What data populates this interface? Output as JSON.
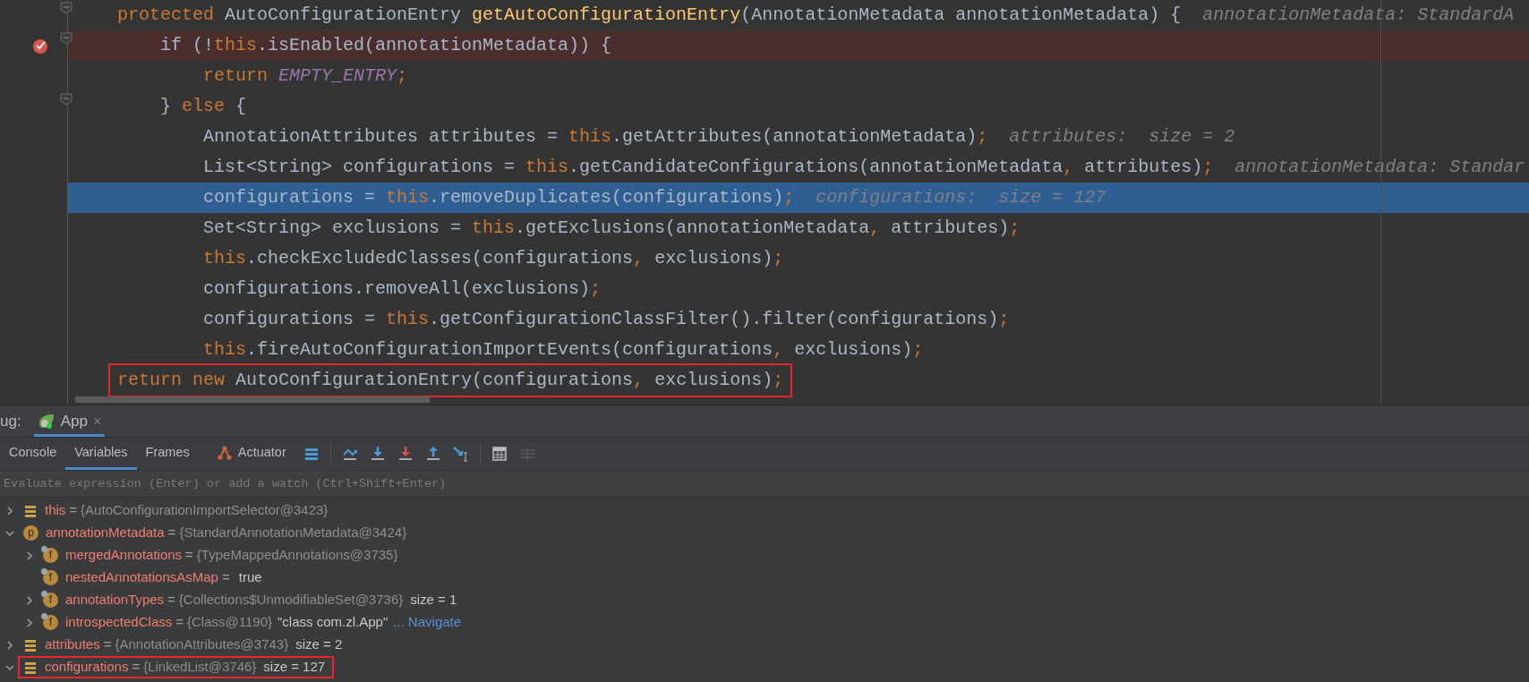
{
  "editor": {
    "lines": [
      {
        "kind": "normal",
        "fold": true,
        "segments": [
          {
            "kind": "keyword",
            "text": "protected "
          },
          {
            "kind": "plain",
            "text": "AutoConfigurationEntry "
          },
          {
            "kind": "method",
            "text": "getAutoConfigurationEntry"
          },
          {
            "kind": "plain",
            "text": "(AnnotationMetadata annotationMetadata) {"
          }
        ],
        "hint": "annotationMetadata: StandardA"
      },
      {
        "kind": "breakpoint",
        "fold": true,
        "segments": [
          {
            "kind": "plain",
            "text": "    if (!"
          },
          {
            "kind": "keyword",
            "text": "this"
          },
          {
            "kind": "plain",
            "text": ".isEnabled(annotationMetadata)) {"
          }
        ]
      },
      {
        "kind": "normal",
        "fold": false,
        "segments": [
          {
            "kind": "keyword",
            "text": "        return "
          },
          {
            "kind": "constant",
            "text": "EMPTY_ENTRY"
          },
          {
            "kind": "punct",
            "text": ";"
          }
        ]
      },
      {
        "kind": "normal",
        "fold": true,
        "segments": [
          {
            "kind": "plain",
            "text": "    } "
          },
          {
            "kind": "keyword",
            "text": "else"
          },
          {
            "kind": "plain",
            "text": " {"
          }
        ]
      },
      {
        "kind": "normal",
        "fold": false,
        "segments": [
          {
            "kind": "plain",
            "text": "        AnnotationAttributes attributes = "
          },
          {
            "kind": "keyword",
            "text": "this"
          },
          {
            "kind": "plain",
            "text": ".getAttributes(annotationMetadata)"
          },
          {
            "kind": "punct",
            "text": ";"
          }
        ],
        "hint": "attributes:  size = 2"
      },
      {
        "kind": "normal",
        "fold": false,
        "segments": [
          {
            "kind": "plain",
            "text": "        List<String> configurations = "
          },
          {
            "kind": "keyword",
            "text": "this"
          },
          {
            "kind": "plain",
            "text": ".getCandidateConfigurations(annotationMetadata"
          },
          {
            "kind": "punct",
            "text": ","
          },
          {
            "kind": "plain",
            "text": " attributes)"
          },
          {
            "kind": "punct",
            "text": ";"
          }
        ],
        "hint": "annotationMetadata: Standar"
      },
      {
        "kind": "execution",
        "fold": false,
        "segments": [
          {
            "kind": "plain",
            "text": "        configurations = "
          },
          {
            "kind": "keyword",
            "text": "this"
          },
          {
            "kind": "plain",
            "text": ".removeDuplicates(configurations)"
          },
          {
            "kind": "punct",
            "text": ";"
          }
        ],
        "hint": "configurations:  size = 127"
      },
      {
        "kind": "normal",
        "fold": false,
        "segments": [
          {
            "kind": "plain",
            "text": "        Set<String> exclusions = "
          },
          {
            "kind": "keyword",
            "text": "this"
          },
          {
            "kind": "plain",
            "text": ".getExclusions(annotationMetadata"
          },
          {
            "kind": "punct",
            "text": ","
          },
          {
            "kind": "plain",
            "text": " attributes)"
          },
          {
            "kind": "punct",
            "text": ";"
          }
        ]
      },
      {
        "kind": "normal",
        "fold": false,
        "segments": [
          {
            "kind": "keyword",
            "text": "        this"
          },
          {
            "kind": "plain",
            "text": ".checkExcludedClasses(configurations"
          },
          {
            "kind": "punct",
            "text": ","
          },
          {
            "kind": "plain",
            "text": " exclusions)"
          },
          {
            "kind": "punct",
            "text": ";"
          }
        ]
      },
      {
        "kind": "normal",
        "fold": false,
        "segments": [
          {
            "kind": "plain",
            "text": "        configurations.removeAll(exclusions)"
          },
          {
            "kind": "punct",
            "text": ";"
          }
        ]
      },
      {
        "kind": "normal",
        "fold": false,
        "segments": [
          {
            "kind": "plain",
            "text": "        configurations = "
          },
          {
            "kind": "keyword",
            "text": "this"
          },
          {
            "kind": "plain",
            "text": ".getConfigurationClassFilter().filter(configurations)"
          },
          {
            "kind": "punct",
            "text": ";"
          }
        ]
      },
      {
        "kind": "normal",
        "fold": false,
        "segments": [
          {
            "kind": "keyword",
            "text": "        this"
          },
          {
            "kind": "plain",
            "text": ".fireAutoConfigurationImportEvents(configurations"
          },
          {
            "kind": "punct",
            "text": ","
          },
          {
            "kind": "plain",
            "text": " exclusions)"
          },
          {
            "kind": "punct",
            "text": ";"
          }
        ]
      },
      {
        "kind": "boxed",
        "fold": false,
        "segments": [
          {
            "kind": "keyword",
            "text": "return "
          },
          {
            "kind": "keyword",
            "text": "new "
          },
          {
            "kind": "plain",
            "text": "AutoConfigurationEntry(configurations"
          },
          {
            "kind": "punct",
            "text": ","
          },
          {
            "kind": "plain",
            "text": " exclusions)"
          },
          {
            "kind": "punct",
            "text": ";"
          }
        ]
      }
    ]
  },
  "debug": {
    "label": "ug:",
    "session_tabs": [
      {
        "label": "App",
        "selected": true,
        "close": "×"
      }
    ],
    "tabs": [
      {
        "label": "Console",
        "selected": false
      },
      {
        "label": "Variables",
        "selected": true
      },
      {
        "label": "Frames",
        "selected": false
      },
      {
        "label": "Actuator",
        "selected": false
      }
    ],
    "watch": {
      "placeholder": "Evaluate expression (Enter) or add a watch (Ctrl+Shift+Enter)"
    },
    "variables": [
      {
        "expanded": false,
        "kind": "variable",
        "name": "this",
        "operator": "=",
        "value": "{AutoConfigurationImportSelector@3423}",
        "boxed": false
      },
      {
        "expanded": true,
        "kind": "parameter",
        "badge": "p",
        "name": "annotationMetadata",
        "operator": "=",
        "value": "{StandardAnnotationMetadata@3424}",
        "boxed": false,
        "children": [
          {
            "expanded": false,
            "kind": "field",
            "badge": "f",
            "name": "mergedAnnotations",
            "operator": "=",
            "value": "{TypeMappedAnnotations@3735}",
            "boxed": false
          },
          {
            "kind": "field",
            "badge": "f",
            "name": "nestedAnnotationsAsMap",
            "operator": "=",
            "literal": "true",
            "boxed": false
          },
          {
            "expanded": false,
            "kind": "field",
            "badge": "f",
            "name": "annotationTypes",
            "operator": "=",
            "value": "{Collections$UnmodifiableSet@3736}",
            "extra": "size = 1",
            "boxed": false
          },
          {
            "expanded": false,
            "kind": "field",
            "badge": "f",
            "name": "introspectedClass",
            "operator": "=",
            "value": "{Class@1190}",
            "literal": "\"class com.zl.App\"",
            "link": "... Navigate",
            "boxed": false
          }
        ]
      },
      {
        "expanded": false,
        "kind": "variable",
        "name": "attributes",
        "operator": "=",
        "value": "{AnnotationAttributes@3743}",
        "extra": "size = 2",
        "boxed": false
      },
      {
        "expanded": true,
        "kind": "variable",
        "name": "configurations",
        "operator": "=",
        "value": "{LinkedList@3746}",
        "extra": "size = 127",
        "boxed": true
      }
    ]
  }
}
